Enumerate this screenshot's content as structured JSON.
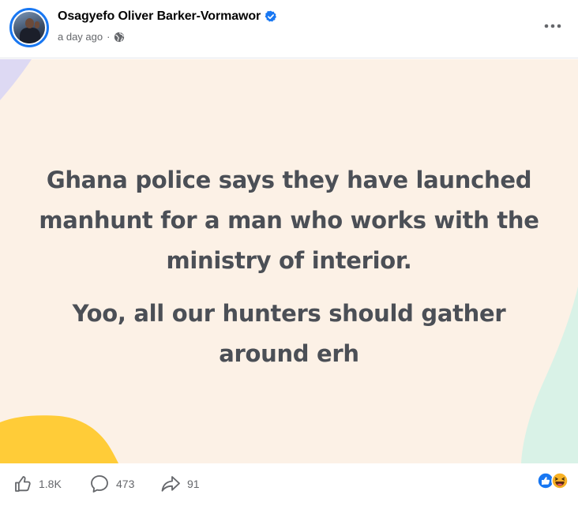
{
  "post": {
    "author_name": "Osagyefo Oliver Barker-Vormawor",
    "timestamp": "a day ago",
    "separator": "·",
    "audience_icon": "globe-icon",
    "verified_icon": "verified-badge-icon",
    "more_icon": "more-options-icon",
    "text_paragraphs": [
      "Ghana police says they have launched manhunt for a man who works with the ministry of interior.",
      "Yoo, all our hunters should gather around erh"
    ],
    "background_color": "#fcf1e6",
    "text_color": "#4b4f56"
  },
  "footer": {
    "like_count": "1.8K",
    "comment_count": "473",
    "share_count": "91",
    "like_icon": "thumbs-up-icon",
    "comment_icon": "comment-bubble-icon",
    "share_icon": "share-arrow-icon",
    "reaction_icons": [
      "like-reaction-icon",
      "haha-reaction-icon"
    ]
  },
  "colors": {
    "brand_blue": "#1877f2",
    "secondary_text": "#65676b"
  }
}
